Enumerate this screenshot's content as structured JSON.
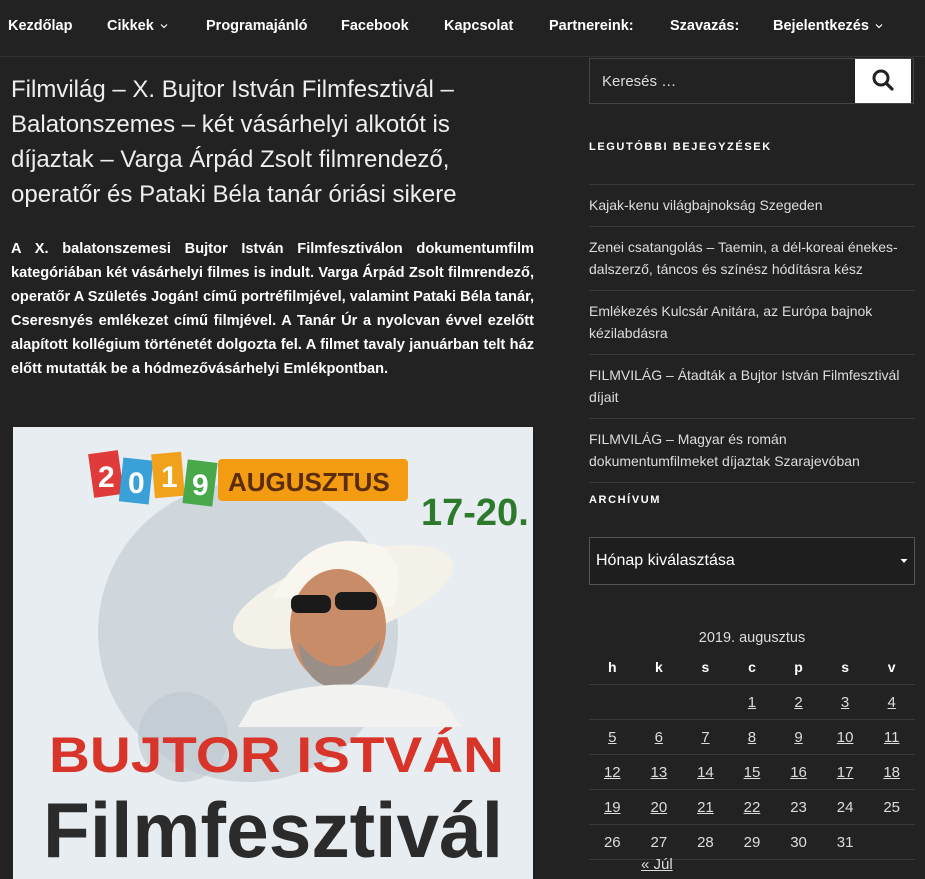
{
  "nav": {
    "items": [
      {
        "label": "Kezdőlap"
      },
      {
        "label": "Cikkek"
      },
      {
        "label": "Programajánló"
      },
      {
        "label": "Facebook"
      },
      {
        "label": "Kapcsolat"
      },
      {
        "label": "Partnereink:"
      },
      {
        "label": "Szavazás:"
      },
      {
        "label": "Bejelentkezés"
      }
    ]
  },
  "article": {
    "title": "Filmvilág – X. Bujtor István Filmfesztivál – Balatonszemes – két vásárhelyi alkotót is díjaztak – Varga Árpád Zsolt filmrendező, operatőr és Pataki Béla tanár óriási sikere",
    "lead": "A X. balatonszemesi Bujtor István Filmfesztiválon dokumentumfilm kategóriában két vásárhelyi filmes is indult. Varga Árpád Zsolt filmrendező, operatőr A Születés Jogán! című portréfilmjével, valamint Pataki Béla tanár, Cseresnyés emlékezet című filmjével.  A Tanár Úr a nyolcvan évvel ezelőtt alapított kollégium történetét dolgozta fel. A filmet tavaly januárban telt ház előtt mutatták be a hódmezővásárhelyi Emlékpontban.",
    "poster": {
      "year_digits": [
        "2",
        "0",
        "1",
        "9"
      ],
      "month": "AUGUSZTUS",
      "days": "17-20.",
      "name": "BUJTOR ISTVÁN",
      "festival": "Filmfesztivál"
    }
  },
  "search": {
    "placeholder": "Keresés …"
  },
  "recent": {
    "title": "LEGUTÓBBI BEJEGYZÉSEK",
    "items": [
      "Kajak-kenu világbajnokság Szegeden",
      "Zenei csatangolás – Taemin, a dél-koreai énekes-dalszerző, táncos és színész hódításra kész",
      "Emlékezés Kulcsár Anitára, az Európa bajnok kézilabdásra",
      "FILMVILÁG – Átadták a Bujtor István Filmfesztivál díjait",
      "FILMVILÁG – Magyar és román dokumentumfilmeket díjaztak Szarajevóban"
    ]
  },
  "archive": {
    "title": "ARCHÍVUM",
    "selected": "Hónap kiválasztása"
  },
  "calendar": {
    "caption": "2019. augusztus",
    "weekdays": [
      "h",
      "k",
      "s",
      "c",
      "p",
      "s",
      "v"
    ],
    "weeks": [
      [
        "",
        "",
        "",
        "1",
        "2",
        "3",
        "4"
      ],
      [
        "5",
        "6",
        "7",
        "8",
        "9",
        "10",
        "11"
      ],
      [
        "12",
        "13",
        "14",
        "15",
        "16",
        "17",
        "18"
      ],
      [
        "19",
        "20",
        "21",
        "22",
        "23",
        "24",
        "25"
      ],
      [
        "26",
        "27",
        "28",
        "29",
        "30",
        "31",
        ""
      ]
    ],
    "linked_days": [
      "1",
      "2",
      "3",
      "4",
      "5",
      "6",
      "7",
      "8",
      "9",
      "10",
      "11",
      "12",
      "13",
      "14",
      "15",
      "16",
      "17",
      "18",
      "19",
      "20",
      "21",
      "22"
    ],
    "prev_label": "« Júl"
  }
}
